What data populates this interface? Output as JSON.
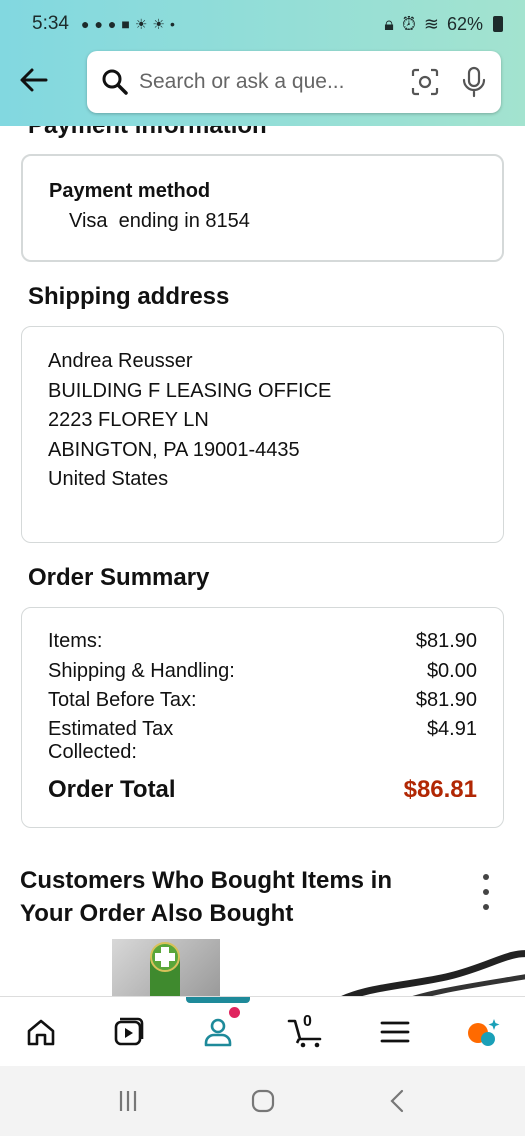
{
  "status_bar": {
    "time": "5:34",
    "battery": "62%"
  },
  "search": {
    "placeholder": "Search or ask a que..."
  },
  "payment": {
    "section_title": "Payment information",
    "label": "Payment method",
    "value": "Visa  ending in 8154"
  },
  "shipping": {
    "section_title": "Shipping address",
    "lines": [
      "Andrea Reusser",
      "BUILDING F LEASING OFFICE",
      "2223 FLOREY LN",
      "ABINGTON, PA 19001-4435",
      "United States"
    ]
  },
  "summary": {
    "section_title": "Order Summary",
    "rows": [
      {
        "label": "Items:",
        "amount": "$81.90"
      },
      {
        "label": "Shipping & Handling:",
        "amount": "$0.00"
      },
      {
        "label": "Total Before Tax:",
        "amount": "$81.90"
      },
      {
        "label": "Estimated Tax",
        "label2": "Collected:",
        "amount": "$4.91"
      }
    ],
    "total_label": "Order Total",
    "total_amount": "$86.81"
  },
  "recommendations": {
    "title": "Customers Who Bought Items in Your Order Also Bought"
  },
  "bottom_nav": {
    "cart_count": "0"
  },
  "colors": {
    "header_start": "#82d8e0",
    "header_end": "#a3e3cf",
    "accent": "#1e8a9a",
    "price_red": "#b12704",
    "badge": "#e0245e"
  },
  "icons": [
    "arrow-left-icon",
    "search-icon",
    "camera-lens-icon",
    "microphone-icon",
    "home-icon",
    "video-icon",
    "account-icon",
    "cart-icon",
    "menu-icon",
    "assistant-icon",
    "kebab-icon"
  ]
}
